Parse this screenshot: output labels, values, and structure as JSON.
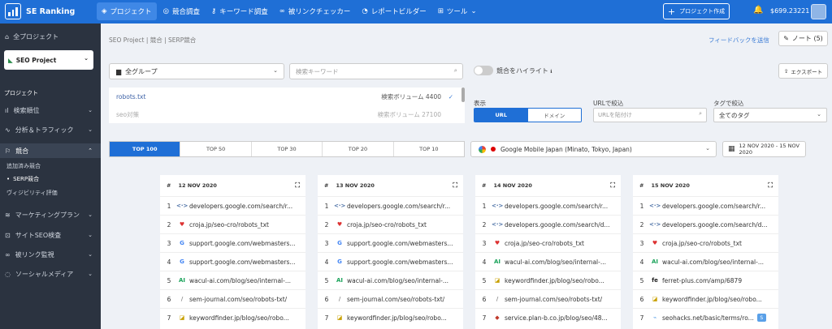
{
  "app": {
    "name": "SE Ranking"
  },
  "nav": {
    "items": [
      {
        "label": "プロジェクト",
        "icon": "layers-icon",
        "active": true
      },
      {
        "label": "競合調査",
        "icon": "target-icon",
        "active": false
      },
      {
        "label": "キーワード調査",
        "icon": "key-icon",
        "active": false
      },
      {
        "label": "被リンクチェッカー",
        "icon": "link-icon",
        "active": false
      },
      {
        "label": "レポートビルダー",
        "icon": "pie-icon",
        "active": false
      },
      {
        "label": "ツール",
        "icon": "grid-icon",
        "active": false
      }
    ]
  },
  "header": {
    "create_project": "プロジェクト作成",
    "balance": "$699.23221"
  },
  "sidebar": {
    "all_projects": "全プロジェクト",
    "project": "SEO Project",
    "section": "プロジェクト",
    "items": [
      {
        "label": "検索順位"
      },
      {
        "label": "分析＆トラフィック"
      },
      {
        "label": "競合"
      },
      {
        "label": "マーケティングプラン"
      },
      {
        "label": "サイトSEO検査"
      },
      {
        "label": "被リンク監視"
      },
      {
        "label": "ソーシャルメディア"
      }
    ],
    "sub_items": [
      {
        "label": "追加済み競合"
      },
      {
        "label": "SERP競合"
      },
      {
        "label": "ヴィジビリティ評価"
      }
    ]
  },
  "breadcrumb": "SEO Project  |  競合  |  SERP競合",
  "feedback": "フィードバックを送信",
  "notes": "ノート (5)",
  "filters": {
    "group": "全グループ",
    "keyword_placeholder": "検索キーワード",
    "highlight_label": "競合をハイライト",
    "export": "エクスポート",
    "display_label": "表示",
    "display_url": "URL",
    "display_domain": "ドメイン",
    "url_filter_label": "URLで絞込",
    "url_placeholder": "URLを貼付け",
    "tag_filter_label": "タグで絞込",
    "tag_value": "全てのタグ"
  },
  "keywords": [
    {
      "keyword": "robots.txt",
      "volume": "検索ボリューム 4400"
    },
    {
      "keyword": "seo対策",
      "volume": "検索ボリューム 27100"
    }
  ],
  "tabs": [
    "TOP 100",
    "TOP 50",
    "TOP 30",
    "TOP 20",
    "TOP 10"
  ],
  "engine": "Google Mobile Japan (Minato, Tokyo, Japan)",
  "date_range": "12 NOV 2020 - 15 NOV 2020",
  "columns": [
    {
      "hash": "#",
      "date": "12 NOV 2020",
      "rows": [
        {
          "rank": "1",
          "icon": "<·>",
          "url": "developers.google.com/search/r..."
        },
        {
          "rank": "2",
          "icon": "♥",
          "url": "croja.jp/seo-cro/robots_txt"
        },
        {
          "rank": "3",
          "icon": "G",
          "url": "support.google.com/webmasters..."
        },
        {
          "rank": "4",
          "icon": "G",
          "url": "support.google.com/webmasters..."
        },
        {
          "rank": "5",
          "icon": "AI",
          "url": "wacul-ai.com/blog/seo/internal-..."
        },
        {
          "rank": "6",
          "icon": "/",
          "url": "sem-journal.com/seo/robots-txt/"
        },
        {
          "rank": "7",
          "icon": "◪",
          "url": "keywordfinder.jp/blog/seo/robo..."
        }
      ]
    },
    {
      "hash": "#",
      "date": "13 NOV 2020",
      "rows": [
        {
          "rank": "1",
          "icon": "<·>",
          "url": "developers.google.com/search/r..."
        },
        {
          "rank": "2",
          "icon": "♥",
          "url": "croja.jp/seo-cro/robots_txt"
        },
        {
          "rank": "3",
          "icon": "G",
          "url": "support.google.com/webmasters..."
        },
        {
          "rank": "4",
          "icon": "G",
          "url": "support.google.com/webmasters..."
        },
        {
          "rank": "5",
          "icon": "AI",
          "url": "wacul-ai.com/blog/seo/internal-..."
        },
        {
          "rank": "6",
          "icon": "/",
          "url": "sem-journal.com/seo/robots-txt/"
        },
        {
          "rank": "7",
          "icon": "◪",
          "url": "keywordfinder.jp/blog/seo/robo..."
        }
      ]
    },
    {
      "hash": "#",
      "date": "14 NOV 2020",
      "rows": [
        {
          "rank": "1",
          "icon": "<·>",
          "url": "developers.google.com/search/r..."
        },
        {
          "rank": "2",
          "icon": "<·>",
          "url": "developers.google.com/search/d..."
        },
        {
          "rank": "3",
          "icon": "♥",
          "url": "croja.jp/seo-cro/robots_txt"
        },
        {
          "rank": "4",
          "icon": "AI",
          "url": "wacul-ai.com/blog/seo/internal-..."
        },
        {
          "rank": "5",
          "icon": "◪",
          "url": "keywordfinder.jp/blog/seo/robo..."
        },
        {
          "rank": "6",
          "icon": "/",
          "url": "sem-journal.com/seo/robots-txt/"
        },
        {
          "rank": "7",
          "icon": "◆",
          "url": "service.plan-b.co.jp/blog/seo/48..."
        }
      ]
    },
    {
      "hash": "#",
      "date": "15 NOV 2020",
      "rows": [
        {
          "rank": "1",
          "icon": "<·>",
          "url": "developers.google.com/search/r..."
        },
        {
          "rank": "2",
          "icon": "<·>",
          "url": "developers.google.com/search/d..."
        },
        {
          "rank": "3",
          "icon": "♥",
          "url": "croja.jp/seo-cro/robots_txt"
        },
        {
          "rank": "4",
          "icon": "AI",
          "url": "wacul-ai.com/blog/seo/internal-..."
        },
        {
          "rank": "5",
          "icon": "fe",
          "url": "ferret-plus.com/amp/6879"
        },
        {
          "rank": "6",
          "icon": "◪",
          "url": "keywordfinder.jp/blog/seo/robo..."
        },
        {
          "rank": "7",
          "icon": "⌁",
          "url": "seohacks.net/basic/terms/ro...",
          "badge": "S"
        }
      ]
    }
  ]
}
